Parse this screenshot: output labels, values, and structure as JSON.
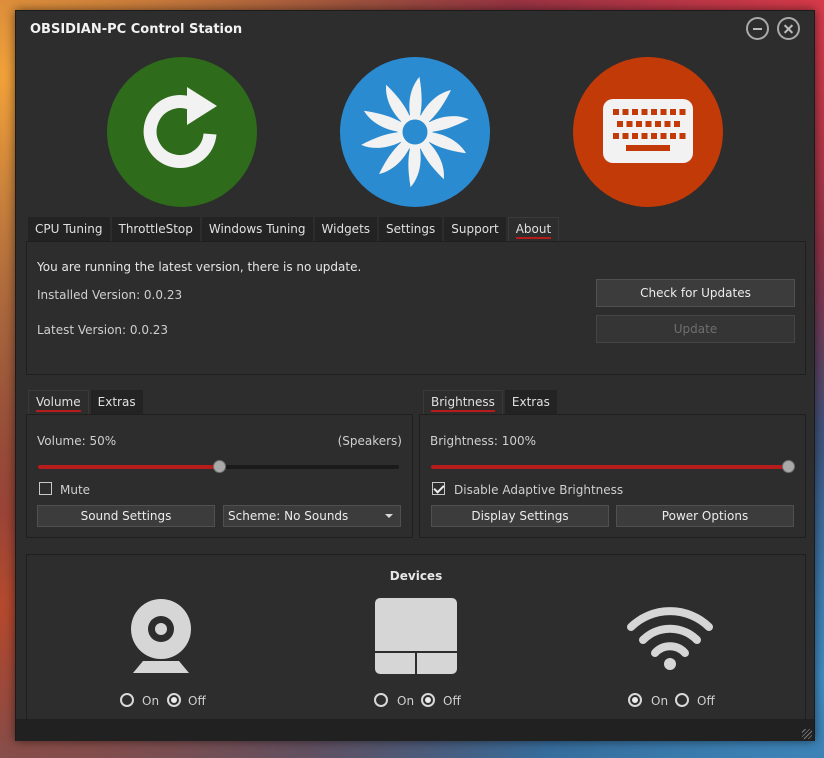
{
  "window": {
    "title": "OBSIDIAN-PC Control Station"
  },
  "top_icons": [
    {
      "name": "refresh-icon",
      "color": "#2e6b1b"
    },
    {
      "name": "fan-icon",
      "color": "#2b8bd0"
    },
    {
      "name": "keyboard-icon",
      "color": "#c23a07"
    }
  ],
  "main_tabs": [
    "CPU Tuning",
    "ThrottleStop",
    "Windows Tuning",
    "Widgets",
    "Settings",
    "Support",
    "About"
  ],
  "about": {
    "status": "You are running the latest version, there is no update.",
    "installed_version": "Installed Version: 0.0.23",
    "latest_version": "Latest Version: 0.0.23",
    "check_button": "Check for Updates",
    "update_button": "Update"
  },
  "volume": {
    "tabs": [
      "Volume",
      "Extras"
    ],
    "label": "Volume: 50%",
    "device": "(Speakers)",
    "level": 0.5,
    "mute_label": "Mute",
    "mute_checked": false,
    "sound_settings": "Sound Settings",
    "scheme": "Scheme: No Sounds"
  },
  "brightness": {
    "tabs": [
      "Brightness",
      "Extras"
    ],
    "label": "Brightness: 100%",
    "level": 1.0,
    "adaptive_label": "Disable Adaptive Brightness",
    "adaptive_checked": true,
    "display_settings": "Display Settings",
    "power_options": "Power Options"
  },
  "devices": {
    "title": "Devices",
    "on_label": "On",
    "off_label": "Off",
    "items": [
      {
        "name": "webcam-icon",
        "state": "off"
      },
      {
        "name": "touchpad-icon",
        "state": "off"
      },
      {
        "name": "wifi-icon",
        "state": "on"
      }
    ]
  },
  "colors": {
    "accent": "#b71c1c",
    "background": "#2d2d2d"
  }
}
